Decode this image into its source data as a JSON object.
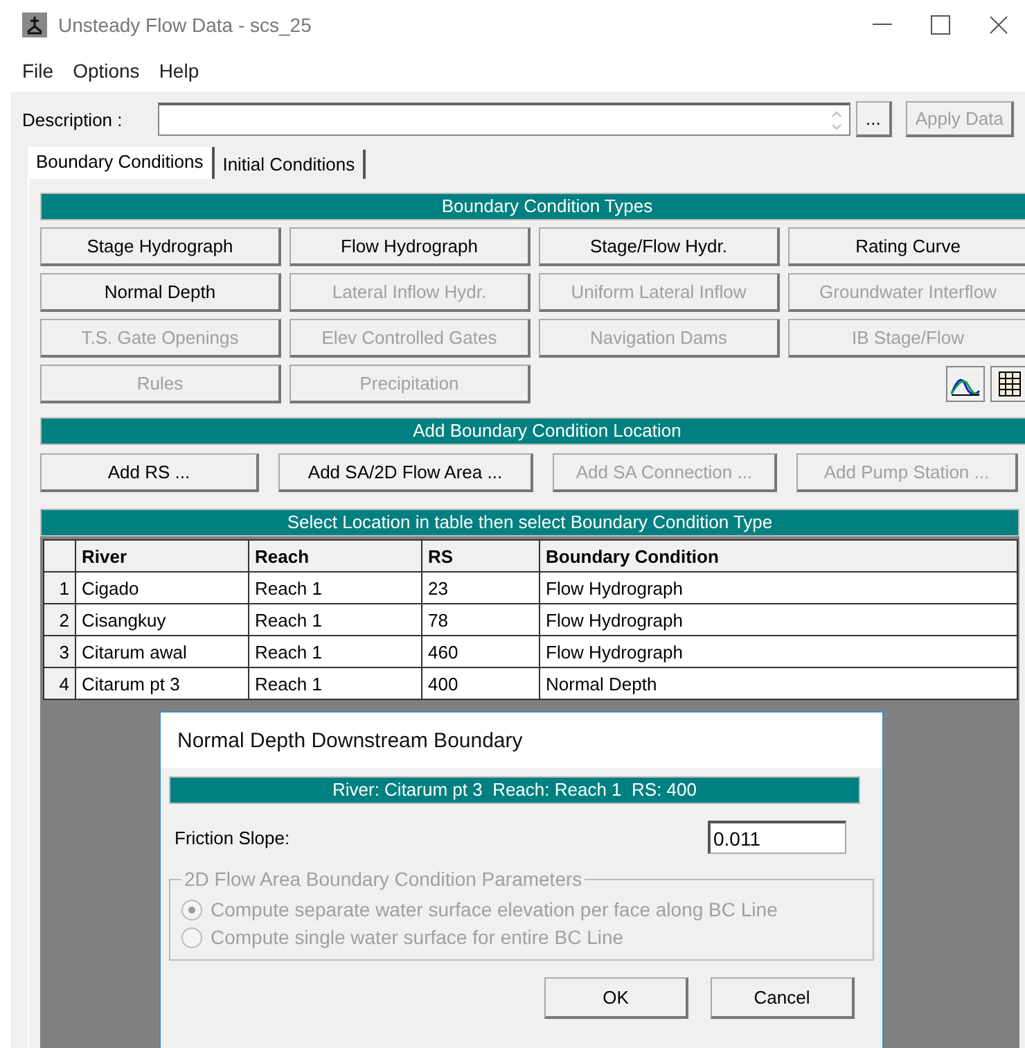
{
  "window": {
    "title": "Unsteady Flow Data - scs_25"
  },
  "menu": [
    "File",
    "Options",
    "Help"
  ],
  "description": {
    "label": "Description :",
    "more": "...",
    "apply": "Apply Data"
  },
  "tabs": [
    {
      "label": "Boundary Conditions",
      "selected": true
    },
    {
      "label": "Initial Conditions",
      "selected": false
    }
  ],
  "types_header": "Boundary Condition Types",
  "type_buttons": [
    {
      "label": "Stage Hydrograph",
      "disabled": false
    },
    {
      "label": "Flow Hydrograph",
      "disabled": false
    },
    {
      "label": "Stage/Flow Hydr.",
      "disabled": false
    },
    {
      "label": "Rating Curve",
      "disabled": false
    },
    {
      "label": "Normal Depth",
      "disabled": false
    },
    {
      "label": "Lateral Inflow Hydr.",
      "disabled": true
    },
    {
      "label": "Uniform Lateral Inflow",
      "disabled": true
    },
    {
      "label": "Groundwater Interflow",
      "disabled": true
    },
    {
      "label": "T.S. Gate Openings",
      "disabled": true
    },
    {
      "label": "Elev Controlled Gates",
      "disabled": true
    },
    {
      "label": "Navigation Dams",
      "disabled": true
    },
    {
      "label": "IB Stage/Flow",
      "disabled": true
    },
    {
      "label": "Rules",
      "disabled": true
    },
    {
      "label": "Precipitation",
      "disabled": true
    }
  ],
  "location_header": "Add Boundary Condition Location",
  "location_buttons": [
    {
      "label": "Add RS ...",
      "disabled": false
    },
    {
      "label": "Add SA/2D Flow Area ...",
      "disabled": false
    },
    {
      "label": "Add SA Connection ...",
      "disabled": true
    },
    {
      "label": "Add Pump Station ...",
      "disabled": true
    }
  ],
  "table": {
    "caption": "Select Location in table then select Boundary Condition Type",
    "columns": [
      "River",
      "Reach",
      "RS",
      "Boundary Condition"
    ],
    "rows": [
      {
        "index": "1",
        "cells": [
          "Cigado",
          "Reach 1",
          "23",
          "Flow Hydrograph"
        ]
      },
      {
        "index": "2",
        "cells": [
          "Cisangkuy",
          "Reach 1",
          "78",
          "Flow Hydrograph"
        ]
      },
      {
        "index": "3",
        "cells": [
          "Citarum awal",
          "Reach 1",
          "460",
          "Flow Hydrograph"
        ]
      },
      {
        "index": "4",
        "cells": [
          "Citarum pt 3",
          "Reach 1",
          "400",
          "Normal Depth"
        ]
      }
    ]
  },
  "dialog": {
    "title": "Normal Depth Downstream Boundary",
    "location": "River: Citarum pt 3  Reach: Reach 1  RS: 400",
    "friction_label": "Friction Slope:",
    "friction_value": "0.011",
    "group": {
      "legend": "2D Flow Area Boundary Condition Parameters",
      "disabled": true,
      "options": [
        {
          "label": "Compute separate water surface elevation per face along BC Line",
          "selected": true
        },
        {
          "label": "Compute single water surface for entire BC Line",
          "selected": false
        }
      ]
    },
    "buttons": [
      "OK",
      "Cancel"
    ]
  }
}
